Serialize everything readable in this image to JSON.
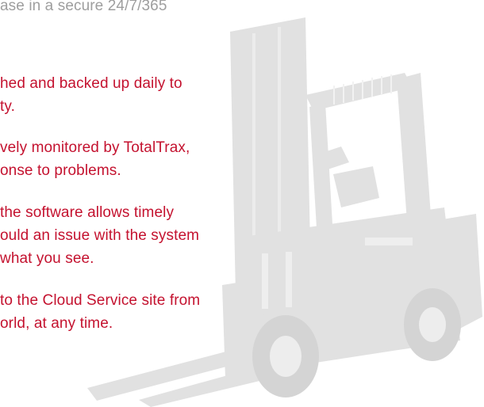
{
  "intro": {
    "line1": "ase in a secure 24/7/365"
  },
  "bullets": [
    {
      "lines": [
        "hed and backed up daily to",
        "ty."
      ]
    },
    {
      "lines": [
        "vely monitored by TotalTrax,",
        "onse to problems."
      ]
    },
    {
      "lines": [
        "the software allows timely",
        "ould an issue with the system",
        "what you see."
      ]
    },
    {
      "lines": [
        "to the Cloud Service site from",
        "orld, at any time."
      ]
    }
  ],
  "illustration": {
    "icon": "forklift-icon",
    "fill_color": "#e1e1e1",
    "text_color": "#c4122f",
    "intro_color": "#9e9e9e"
  }
}
